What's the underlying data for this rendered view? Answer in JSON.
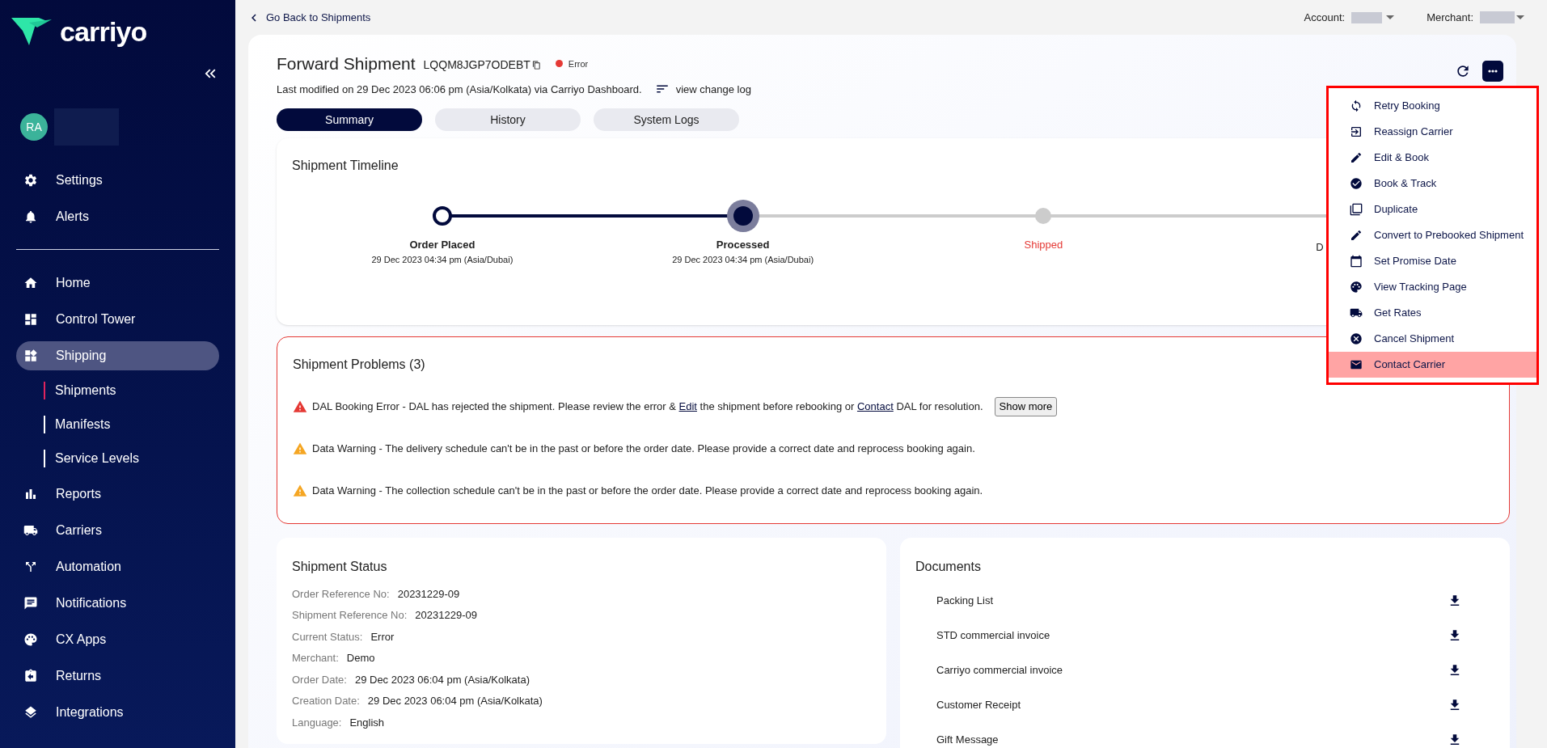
{
  "sidebar": {
    "logo": "carriyo",
    "avatar": {
      "initials": "RA"
    },
    "top_items": [
      {
        "label": "Settings"
      },
      {
        "label": "Alerts"
      }
    ],
    "items": [
      {
        "label": "Home",
        "selected": false
      },
      {
        "label": "Control Tower",
        "selected": false
      },
      {
        "label": "Shipping",
        "selected": true,
        "children": [
          {
            "label": "Shipments",
            "selected": true
          },
          {
            "label": "Manifests",
            "selected": false
          },
          {
            "label": "Service Levels",
            "selected": false
          }
        ]
      },
      {
        "label": "Reports",
        "selected": false
      },
      {
        "label": "Carriers",
        "selected": false
      },
      {
        "label": "Automation",
        "selected": false
      },
      {
        "label": "Notifications",
        "selected": false
      },
      {
        "label": "CX Apps",
        "selected": false
      },
      {
        "label": "Returns",
        "selected": false
      },
      {
        "label": "Integrations",
        "selected": false
      }
    ]
  },
  "topbar": {
    "back": "Go Back to Shipments",
    "account_label": "Account:",
    "merchant_label": "Merchant:"
  },
  "header": {
    "title": "Forward Shipment",
    "shipment_id": "LQQM8JGP7ODEBT",
    "status": {
      "label": "Error",
      "color": "#e53935"
    },
    "modified": "Last modified on 29 Dec 2023 06:06 pm (Asia/Kolkata) via Carriyo Dashboard.",
    "change_log": "view change log"
  },
  "tabs": [
    {
      "label": "Summary",
      "selected": true
    },
    {
      "label": "History",
      "selected": false
    },
    {
      "label": "System Logs",
      "selected": false
    }
  ],
  "timeline": {
    "title": "Shipment Timeline",
    "steps": [
      {
        "label": "Order Placed",
        "time": "29 Dec 2023 04:34 pm (Asia/Dubai)",
        "kind": "done"
      },
      {
        "label": "Processed",
        "time": "29 Dec 2023 04:34 pm (Asia/Dubai)",
        "kind": "current"
      },
      {
        "label": "Shipped",
        "kind": "failed"
      }
    ],
    "next_label": "D"
  },
  "problems": {
    "title": "Shipment Problems (3)",
    "items": [
      {
        "kind": "error",
        "parts": [
          {
            "text": "DAL Booking Error - DAL has rejected the shipment. Please review the error & "
          },
          {
            "link": "Edit"
          },
          {
            "text": " the shipment before rebooking or "
          },
          {
            "link": "Contact"
          },
          {
            "text": " DAL for resolution."
          }
        ],
        "button": "Show more"
      },
      {
        "kind": "warning",
        "parts": [
          {
            "text": "Data Warning - The delivery schedule can't be in the past or before the order date. Please provide a correct date and reprocess booking again."
          }
        ]
      },
      {
        "kind": "warning",
        "parts": [
          {
            "text": "Data Warning - The collection schedule can't be in the past or before the order date. Please provide a correct date and reprocess booking again."
          }
        ]
      }
    ]
  },
  "shipment_status": {
    "title": "Shipment Status",
    "fields": [
      {
        "label": "Order Reference No:",
        "value": "20231229-09"
      },
      {
        "label": "Shipment Reference No:",
        "value": "20231229-09"
      },
      {
        "label": "Current Status:",
        "value": "Error"
      },
      {
        "label": "Merchant:",
        "value": "Demo"
      },
      {
        "label": "Order Date:",
        "value": "29 Dec 2023 06:04 pm (Asia/Kolkata)"
      },
      {
        "label": "Creation Date:",
        "value": "29 Dec 2023 06:04 pm (Asia/Kolkata)"
      },
      {
        "label": "Language:",
        "value": "English"
      }
    ]
  },
  "documents": {
    "title": "Documents",
    "items": [
      "Packing List",
      "STD commercial invoice",
      "Carriyo commercial invoice",
      "Customer Receipt",
      "Gift Message"
    ]
  },
  "actions_menu": {
    "items": [
      {
        "label": "Retry Booking",
        "highlighted": false
      },
      {
        "label": "Reassign Carrier",
        "highlighted": false
      },
      {
        "label": "Edit & Book",
        "highlighted": false
      },
      {
        "label": "Book & Track",
        "highlighted": false
      },
      {
        "label": "Duplicate",
        "highlighted": false
      },
      {
        "label": "Convert to Prebooked Shipment",
        "highlighted": false
      },
      {
        "label": "Set Promise Date",
        "highlighted": false
      },
      {
        "label": "View Tracking Page",
        "highlighted": false
      },
      {
        "label": "Get Rates",
        "highlighted": false
      },
      {
        "label": "Cancel Shipment",
        "highlighted": false
      },
      {
        "label": "Contact Carrier",
        "highlighted": true
      }
    ]
  }
}
